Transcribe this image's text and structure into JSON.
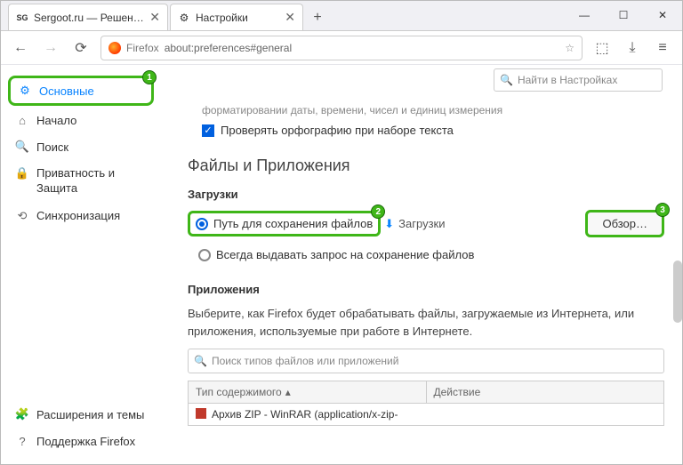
{
  "tabs": [
    {
      "favicon": "SG",
      "title": "Sergoot.ru — Решение ваши"
    },
    {
      "favicon": "⚙",
      "title": "Настройки"
    }
  ],
  "window": {
    "min": "—",
    "max": "☐",
    "close": "✕"
  },
  "url": {
    "label": "Firefox",
    "text": "about:preferences#general"
  },
  "searchSettings": {
    "placeholder": "Найти в Настройках"
  },
  "sidebar": {
    "items": [
      {
        "label": "Основные"
      },
      {
        "label": "Начало"
      },
      {
        "label": "Поиск"
      },
      {
        "label": "Приватность и Защита"
      },
      {
        "label": "Синхронизация"
      }
    ],
    "bottom": [
      {
        "label": "Расширения и темы"
      },
      {
        "label": "Поддержка Firefox"
      }
    ]
  },
  "main": {
    "truncated": "форматировании даты, времени, чисел и единиц измерения",
    "spellcheck": "Проверять орфографию при наборе текста",
    "filesHeading": "Файлы и Приложения",
    "downloadsHeading": "Загрузки",
    "savePathLabel": "Путь для сохранения файлов",
    "downloadsFolder": "Загрузки",
    "browseBtn": "Обзор…",
    "alwaysAsk": "Всегда выдавать запрос на сохранение файлов",
    "appsHeading": "Приложения",
    "appsDesc": "Выберите, как Firefox будет обрабатывать файлы, загружаемые из Интернета, или приложения, используемые при работе в Интернете.",
    "appsSearchPlaceholder": "Поиск типов файлов или приложений",
    "tableHeaders": {
      "type": "Тип содержимого",
      "action": "Действие"
    },
    "tableRow": "Архив ZIP - WinRAR (application/x-zip-"
  },
  "badges": {
    "1": "1",
    "2": "2",
    "3": "3"
  }
}
